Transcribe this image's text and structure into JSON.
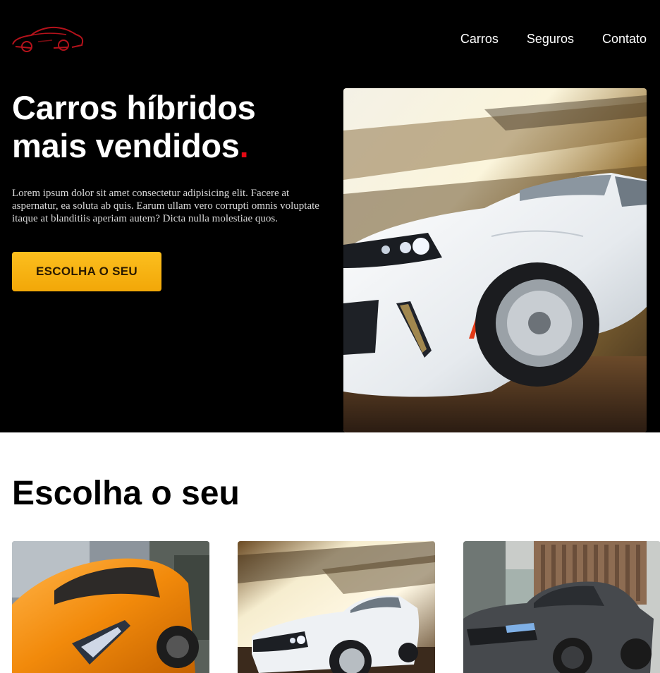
{
  "header": {
    "logo_alt": "car-logo",
    "nav": [
      {
        "label": "Carros"
      },
      {
        "label": "Seguros"
      },
      {
        "label": "Contato"
      }
    ]
  },
  "hero": {
    "title_line1": "Carros híbridos",
    "title_line2": "mais vendidos",
    "title_dot": ".",
    "text": "Lorem ipsum dolor sit amet consectetur adipisicing elit. Facere at aspernatur, ea soluta ab quis. Earum ullam vero corrupti omnis voluptate itaque at blanditiis aperiam autem? Dicta nulla molestiae quos.",
    "cta_label": "ESCOLHA O SEU",
    "image": "white-sports-car-photo"
  },
  "catalog": {
    "title": "Escolha o seu",
    "cards": [
      {
        "image": "orange-supercar-photo"
      },
      {
        "image": "white-sports-car-photo"
      },
      {
        "image": "gray-sedan-photo"
      }
    ]
  },
  "colors": {
    "background_dark": "#000000",
    "accent_red": "#e50914",
    "cta_yellow": "#f7b213",
    "text_light": "#ffffff"
  }
}
